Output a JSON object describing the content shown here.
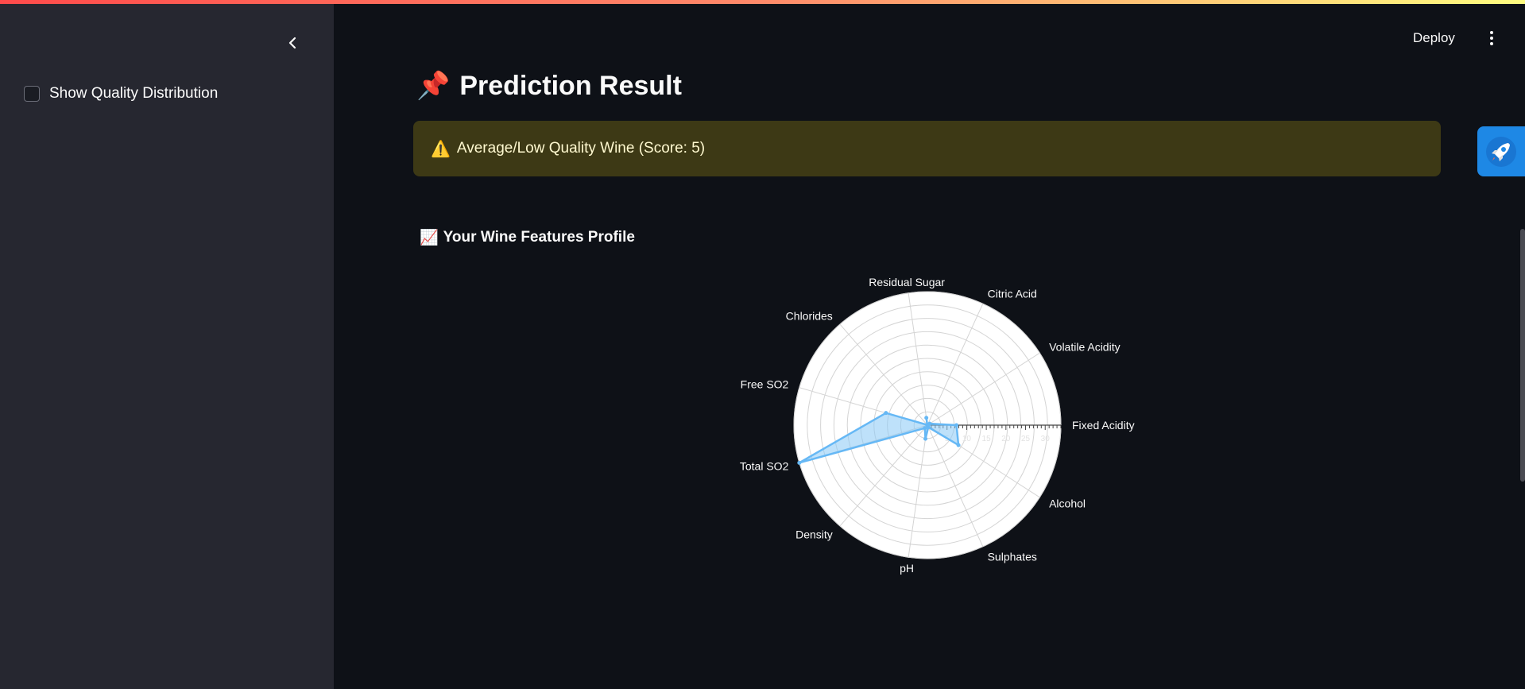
{
  "sidebar": {
    "collapse_icon": "chevron-left-icon",
    "checkbox_label": "Show Quality Distribution",
    "checkbox_checked": false
  },
  "header": {
    "deploy_label": "Deploy",
    "menu_icon": "more-vertical-icon"
  },
  "main": {
    "title_emoji": "📌",
    "title": "Prediction Result",
    "alert": {
      "icon": "⚠️",
      "text": "Average/Low Quality Wine (Score: 5)",
      "color": "#3d3915"
    },
    "section_emoji": "📈",
    "section_title": "Your Wine Features Profile"
  },
  "rocket_icon": "rocket-icon",
  "chart_data": {
    "type": "radar",
    "categories": [
      "Fixed Acidity",
      "Volatile Acidity",
      "Citric Acid",
      "Residual Sugar",
      "Chlorides",
      "Free SO2",
      "Total SO2",
      "Density",
      "pH",
      "Sulphates",
      "Alcohol"
    ],
    "values": [
      7.4,
      0.7,
      0,
      1.9,
      0.076,
      11,
      34,
      0.9978,
      3.51,
      0.56,
      9.4
    ],
    "rlim": [
      0,
      34
    ],
    "radial_ticks": [
      "5",
      "10",
      "15",
      "20",
      "25",
      "30"
    ],
    "fill_color": "#89c8f5",
    "line_color": "#66b8f5"
  }
}
